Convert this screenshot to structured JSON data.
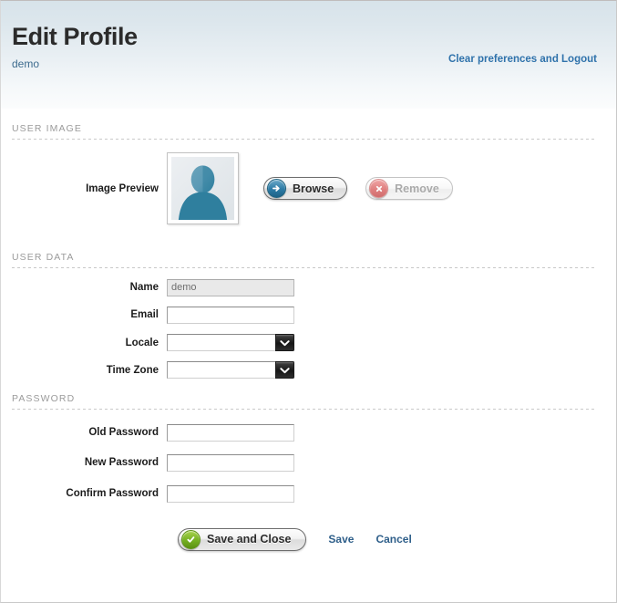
{
  "header": {
    "title": "Edit Profile",
    "subtitle": "demo",
    "logout_link": "Clear preferences and Logout"
  },
  "sections": {
    "user_image": {
      "heading": "USER IMAGE",
      "image_preview_label": "Image Preview",
      "avatar_icon": "user-silhouette-icon",
      "browse_button": "Browse",
      "browse_icon": "arrow-right-circle-icon",
      "remove_button": "Remove",
      "remove_icon": "x-circle-icon",
      "remove_disabled": true
    },
    "user_data": {
      "heading": "USER DATA",
      "fields": [
        {
          "label": "Name",
          "type": "text",
          "value": "demo",
          "placeholder": "",
          "disabled": true
        },
        {
          "label": "Email",
          "type": "text",
          "value": "",
          "placeholder": "",
          "disabled": false
        },
        {
          "label": "Locale",
          "type": "select",
          "value": "",
          "options": []
        },
        {
          "label": "Time Zone",
          "type": "select",
          "value": "",
          "options": []
        }
      ]
    },
    "password": {
      "heading": "PASSWORD",
      "fields": [
        {
          "label": "Old Password",
          "type": "password",
          "value": "",
          "placeholder": ""
        },
        {
          "label": "New Password",
          "type": "password",
          "value": "",
          "placeholder": ""
        },
        {
          "label": "Confirm Password",
          "type": "password",
          "value": "",
          "placeholder": ""
        }
      ]
    }
  },
  "footer": {
    "save_and_close": "Save and Close",
    "save_and_close_icon": "check-circle-icon",
    "save": "Save",
    "cancel": "Cancel"
  },
  "colors": {
    "header_gradient_top": "#d7e3ea",
    "header_gradient_bottom": "#fbfcfd",
    "link": "#2f72ab",
    "section_heading": "#9b9b9b",
    "accent_blue": "#2d7ba5",
    "accent_green": "#74b022",
    "accent_red": "#e08080",
    "avatar_fill": "#2f7f9e"
  }
}
